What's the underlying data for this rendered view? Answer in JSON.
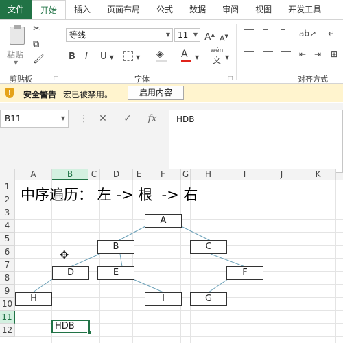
{
  "tabs": [
    "文件",
    "开始",
    "插入",
    "页面布局",
    "公式",
    "数据",
    "审阅",
    "视图",
    "开发工具"
  ],
  "ribbon": {
    "paste_label": "粘贴",
    "clipboard_label": "剪贴板",
    "font_label": "字体",
    "align_label": "对齐方式",
    "font_name": "等线",
    "font_size": "11",
    "bold": "B",
    "italic": "I",
    "underline": "U",
    "grow_font": "A",
    "shrink_font": "A",
    "font_color": "A",
    "phonetic_top": "wén",
    "phonetic_bottom": "文",
    "accent_red": "#e0241b"
  },
  "security": {
    "label": "安全警告",
    "message": "宏已被禁用。",
    "button": "启用内容"
  },
  "formula": {
    "name_box": "B11",
    "content": "HDB",
    "fx": "fx"
  },
  "grid": {
    "columns": [
      "A",
      "B",
      "C",
      "D",
      "E",
      "F",
      "G",
      "H",
      "I",
      "J",
      "K"
    ],
    "rows": [
      "1",
      "2",
      "3",
      "4",
      "5",
      "6",
      "7",
      "8",
      "9",
      "10",
      "11",
      "12"
    ],
    "title": "中序遍历： 左 -> 根  -> 右",
    "nodes": [
      "A",
      "B",
      "C",
      "D",
      "E",
      "F",
      "H",
      "I",
      "G"
    ],
    "active_value": "HDB"
  },
  "colors": {
    "excel_green": "#217346",
    "line": "#6aa0b8"
  }
}
